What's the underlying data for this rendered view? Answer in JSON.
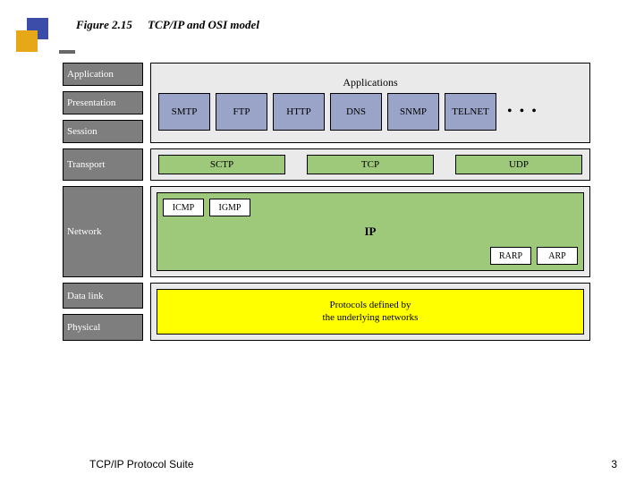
{
  "header": {
    "figure_num": "Figure 2.15",
    "title": "TCP/IP and OSI model"
  },
  "osi_layers": {
    "application": "Application",
    "presentation": "Presentation",
    "session": "Session",
    "transport": "Transport",
    "network": "Network",
    "datalink": "Data link",
    "physical": "Physical"
  },
  "apps": {
    "heading": "Applications",
    "items": [
      "SMTP",
      "FTP",
      "HTTP",
      "DNS",
      "SNMP",
      "TELNET"
    ],
    "ellipsis": "• • •"
  },
  "transport": {
    "protocols": [
      "SCTP",
      "TCP",
      "UDP"
    ]
  },
  "network": {
    "top": [
      "ICMP",
      "IGMP"
    ],
    "center": "IP",
    "bottom": [
      "RARP",
      "ARP"
    ]
  },
  "lower": {
    "text": "Protocols defined by\nthe underlying networks"
  },
  "footer": {
    "left": "TCP/IP Protocol Suite",
    "page": "3"
  }
}
